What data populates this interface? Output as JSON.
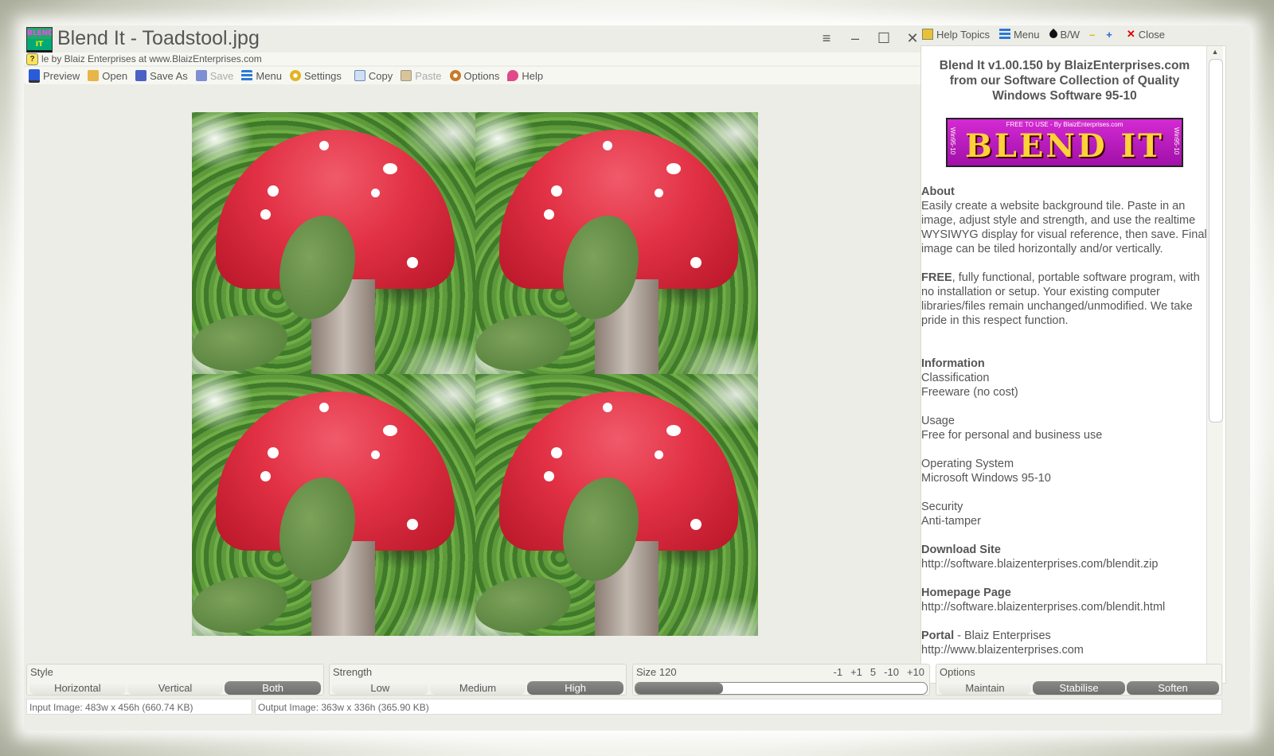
{
  "window": {
    "title": "Blend It - Toadstool.jpg",
    "subtitle": "le by Blaiz Enterprises at www.BlaizEnterprises.com",
    "logo_text_1": "BLEND",
    "logo_text_2": "IT",
    "buttons": {
      "menu": "≡",
      "minimize": "–",
      "maximize": "☐",
      "close": "✕"
    }
  },
  "toolbar": {
    "preview": "Preview",
    "open": "Open",
    "save_as": "Save As",
    "save": "Save",
    "menu": "Menu",
    "settings": "Settings",
    "copy": "Copy",
    "paste": "Paste",
    "options": "Options",
    "help": "Help"
  },
  "helpbar": {
    "help_topics": "Help Topics",
    "menu": "Menu",
    "bw": "B/W",
    "minus": "–",
    "plus": "+",
    "close": "Close"
  },
  "help": {
    "heading_1": "Blend It v1.00.150 by BlaizEnterprises.com",
    "heading_2": "from our Software Collection of Quality",
    "heading_3": "Windows Software 95-10",
    "banner_top": "FREE TO USE - By BlaizEnterprises.com",
    "banner_big": "BLEND IT",
    "banner_side": "Win95-10",
    "about_title": "About",
    "about_text": "Easily create a website background tile.  Paste in an image, adjust style and strength, and use the realtime WYSIWYG display for visual reference, then save.  Final image can be tiled horizontally and/or vertically.",
    "free_title": "FREE",
    "free_text": ", fully functional, portable software program, with no installation or setup. Your existing computer libraries/files remain unchanged/unmodified.  We take pride in this respect function.",
    "info_title": "Information",
    "class_label": "Classification",
    "class_value": "Freeware (no cost)",
    "usage_label": "Usage",
    "usage_value": "Free for personal and business use",
    "os_label": "Operating System",
    "os_value": "Microsoft Windows 95-10",
    "security_label": "Security",
    "security_value": "Anti-tamper",
    "download_title": "Download Site",
    "download_value": "http://software.blaizenterprises.com/blendit.zip",
    "homepage_title": "Homepage Page",
    "homepage_value": "http://software.blaizenterprises.com/blendit.html",
    "portal_title": "Portal",
    "portal_text": " - Blaiz Enterprises",
    "portal_value": "http://www.blaizenterprises.com"
  },
  "controls": {
    "style": {
      "label": "Style",
      "options": [
        "Horizontal",
        "Vertical",
        "Both"
      ],
      "selected": "Both"
    },
    "strength": {
      "label": "Strength",
      "options": [
        "Low",
        "Medium",
        "High"
      ],
      "selected": "High"
    },
    "size": {
      "label": "Size 120",
      "buttons": [
        "-1",
        "+1",
        "5",
        "-10",
        "+10"
      ],
      "level": 0.3
    },
    "options": {
      "label": "Options",
      "options": [
        "Maintain",
        "Stabilise",
        "Soften"
      ],
      "selected": [
        "Stabilise",
        "Soften"
      ]
    }
  },
  "status": {
    "input": "Input Image: 483w x 456h (660.74 KB)",
    "output": "Output Image: 363w x 336h (365.90 KB)"
  },
  "colors": {
    "accent": "#e23145",
    "selected": "#7a7a78",
    "background": "#ecede6"
  }
}
